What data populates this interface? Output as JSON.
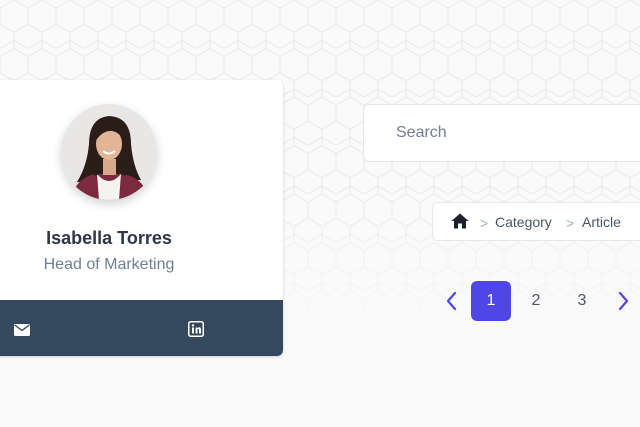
{
  "colors": {
    "accent": "#4f46e5",
    "footer": "#34495e",
    "name": "#2d3748",
    "muted": "#718096"
  },
  "profile": {
    "name": "Isabella Torres",
    "role": "Head of Marketing",
    "avatar_icon": "profile-photo",
    "social": [
      {
        "icon": "envelope-icon"
      },
      {
        "icon": "linkedin-icon"
      }
    ]
  },
  "search": {
    "placeholder": "Search",
    "value": ""
  },
  "breadcrumb": {
    "home_icon": "home-icon",
    "separator": ">",
    "items": [
      "Category",
      "Article"
    ]
  },
  "pagination": {
    "prev_icon": "chevron-left-icon",
    "next_icon": "chevron-right-icon",
    "pages": [
      "1",
      "2",
      "3"
    ],
    "current": "1"
  }
}
